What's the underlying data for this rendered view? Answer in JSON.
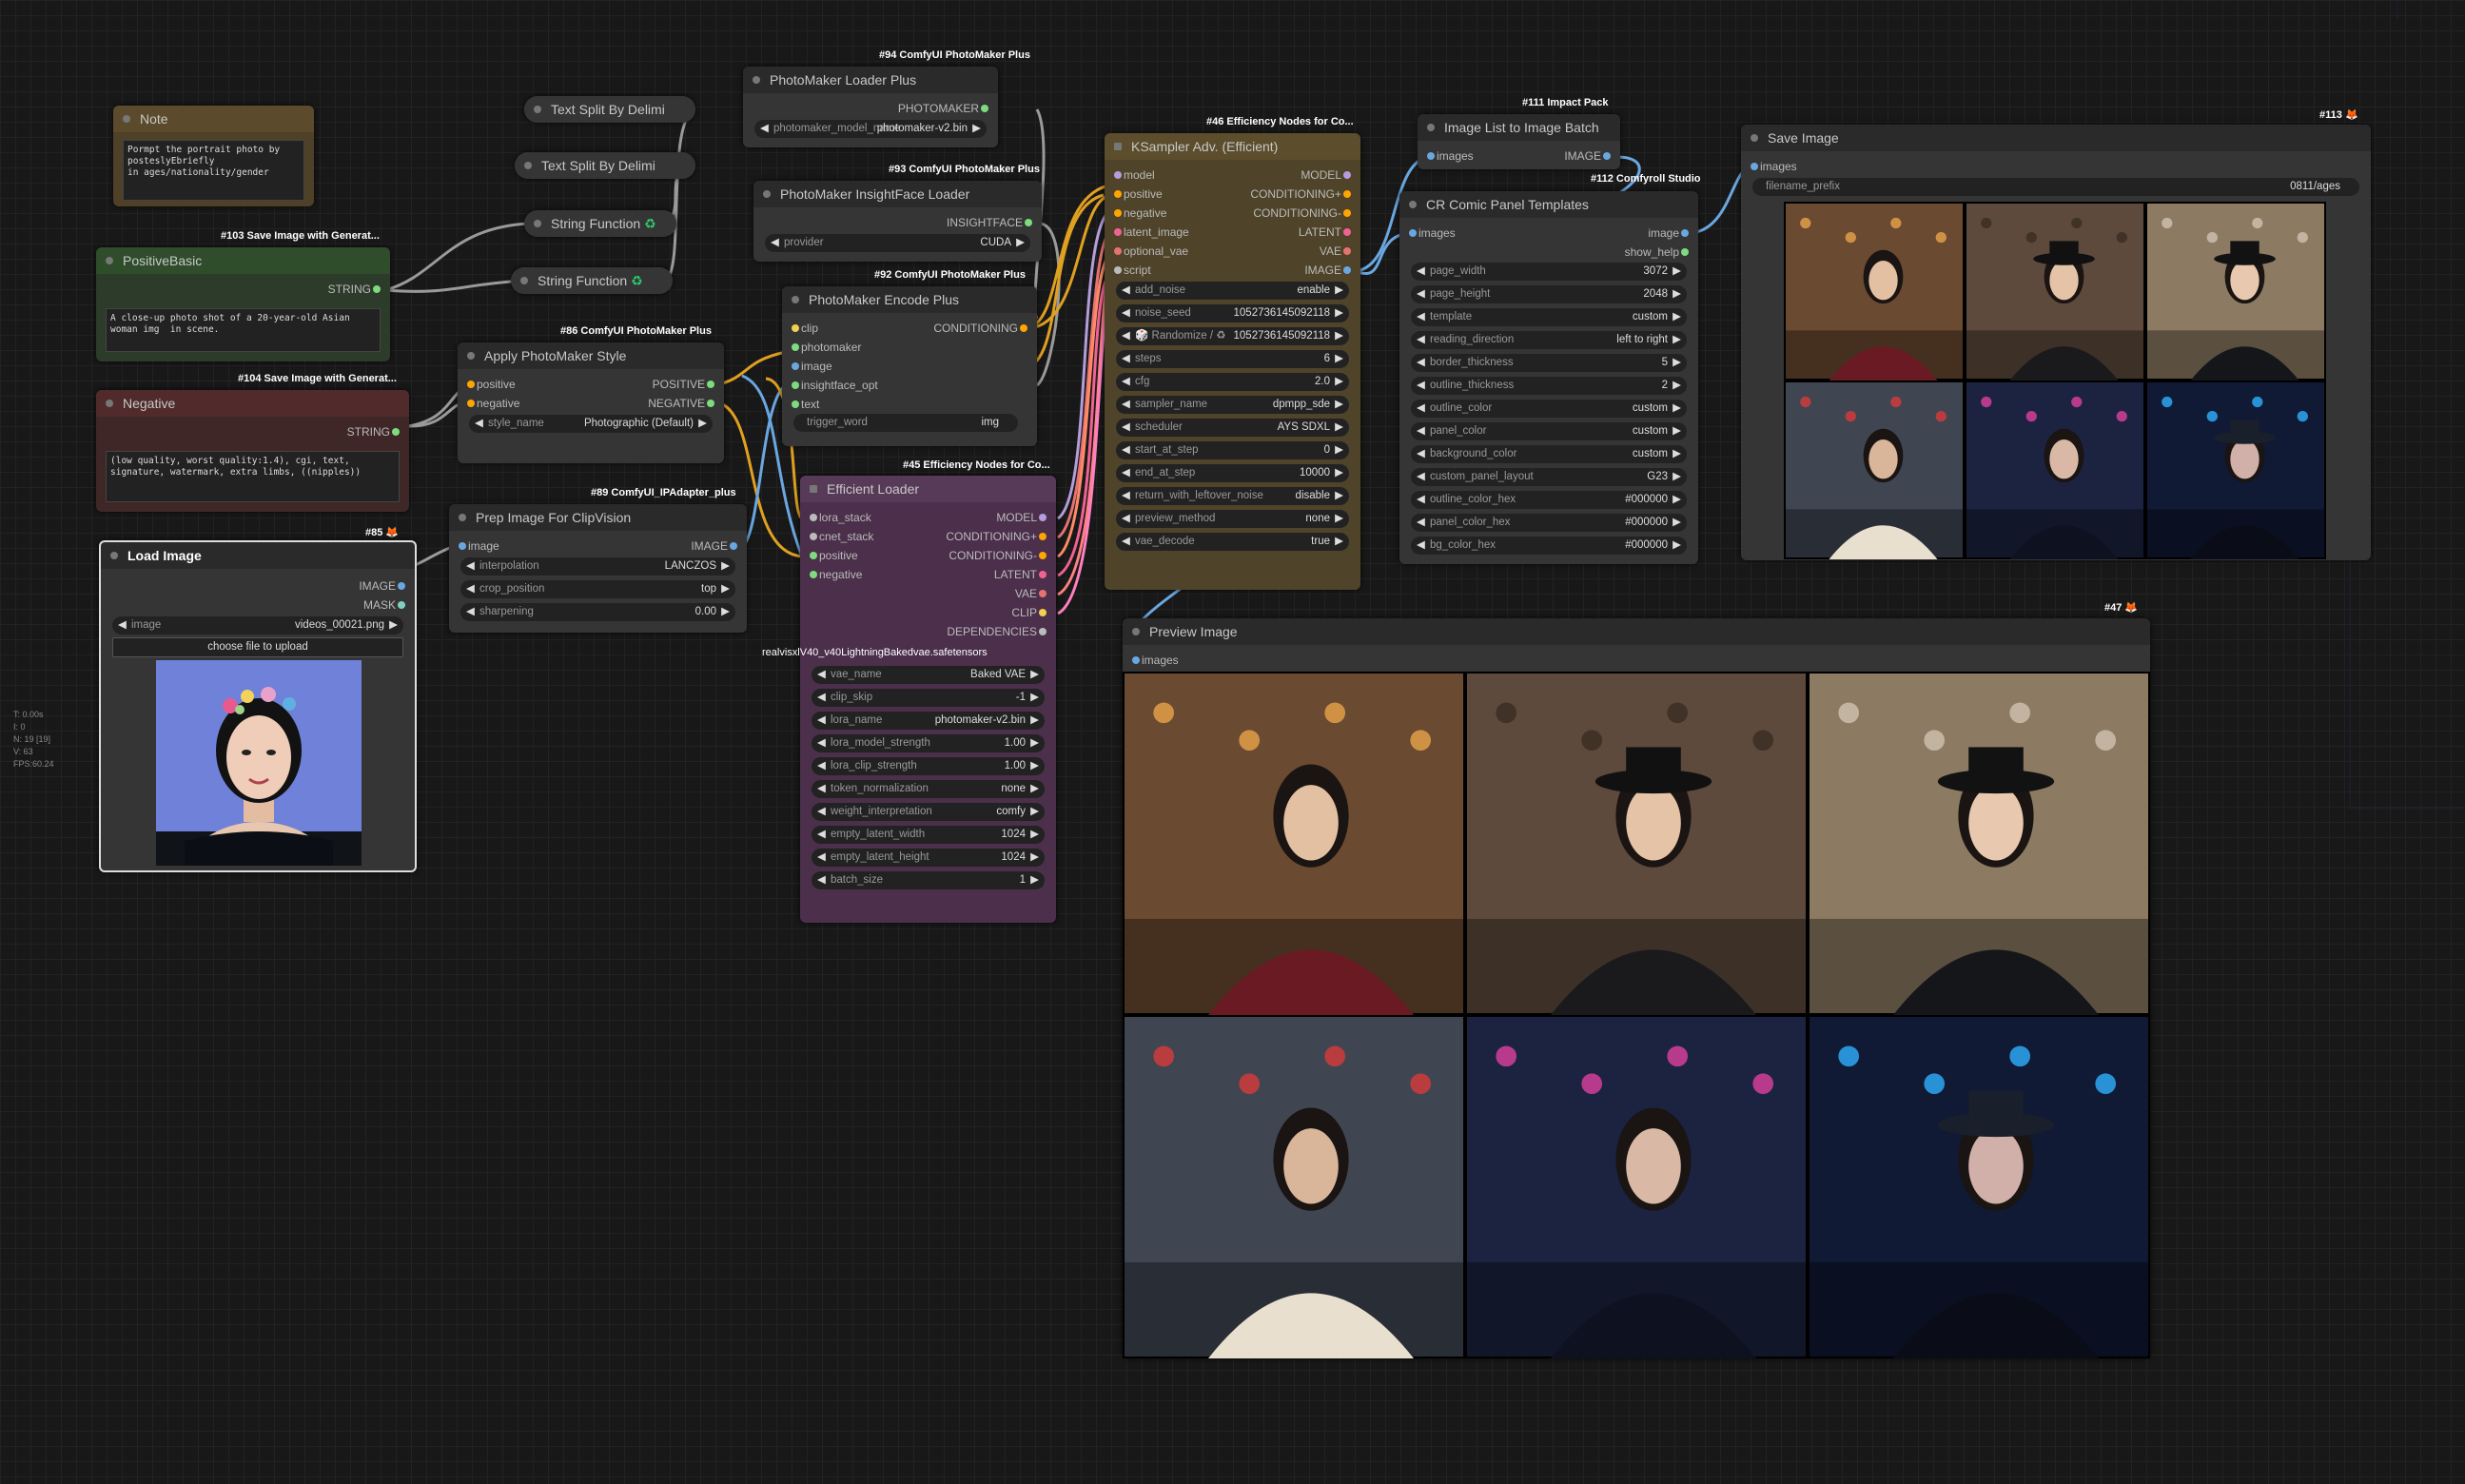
{
  "stats": [
    "T: 0.00s",
    "I: 0",
    "N: 19 [19]",
    "V: 63",
    "FPS:60.24"
  ],
  "note": {
    "title": "Note",
    "text": "Pormpt the portrait photo by\nposteslyEbriefly\nin ages/nationality/gender"
  },
  "positive": {
    "badge": "#103 Save Image with Generat...",
    "title": "PositiveBasic",
    "out": "STRING",
    "text": "A close-up photo shot of a 20-year-old Asian woman img  in scene."
  },
  "negative": {
    "badge": "#104 Save Image with Generat...",
    "title": "Negative",
    "out": "STRING",
    "text": "(low quality, worst quality:1.4), cgi, text, signature, watermark, extra limbs, ((nipples))"
  },
  "load_image": {
    "badge": "#85",
    "title": "Load Image",
    "out1": "IMAGE",
    "out2": "MASK",
    "w_name": "image",
    "w_val": "videos_00021.png",
    "upload": "choose file to upload"
  },
  "text_split1": {
    "title": "Text Split By Delimi"
  },
  "text_split2": {
    "title": "Text Split By Delimi"
  },
  "string_fn1": {
    "title": "String Function"
  },
  "string_fn2": {
    "title": "String Function"
  },
  "apply_style": {
    "badge": "#86 ComfyUI PhotoMaker Plus",
    "title": "Apply PhotoMaker Style",
    "in1": "positive",
    "in2": "negative",
    "out1": "POSITIVE",
    "out2": "NEGATIVE",
    "w_name": "style_name",
    "w_val": "Photographic (Default)"
  },
  "prep_clip": {
    "badge": "#89 ComfyUI_IPAdapter_plus",
    "title": "Prep Image For ClipVision",
    "in1": "image",
    "out1": "IMAGE",
    "w": [
      {
        "n": "interpolation",
        "v": "LANCZOS"
      },
      {
        "n": "crop_position",
        "v": "top"
      },
      {
        "n": "sharpening",
        "v": "0.00"
      }
    ]
  },
  "pm_loader": {
    "badge": "#94 ComfyUI PhotoMaker Plus",
    "title": "PhotoMaker Loader Plus",
    "out1": "PHOTOMAKER",
    "w_name": "photomaker_model_name",
    "w_val": "photomaker-v2.bin"
  },
  "pm_insight": {
    "badge": "#93 ComfyUI PhotoMaker Plus",
    "title": "PhotoMaker InsightFace Loader",
    "out1": "INSIGHTFACE",
    "w_name": "provider",
    "w_val": "CUDA"
  },
  "pm_encode": {
    "badge": "#92 ComfyUI PhotoMaker Plus",
    "title": "PhotoMaker Encode Plus",
    "ins": [
      "clip",
      "photomaker",
      "image",
      "insightface_opt",
      "text"
    ],
    "out1": "CONDITIONING",
    "w_name": "trigger_word",
    "w_val": "img"
  },
  "eff_loader": {
    "badge": "#45 Efficiency Nodes for Co...",
    "title": "Efficient Loader",
    "ins": [
      "lora_stack",
      "cnet_stack",
      "positive",
      "negative"
    ],
    "outs": [
      "MODEL",
      "CONDITIONING+",
      "CONDITIONING-",
      "LATENT",
      "VAE",
      "CLIP",
      "DEPENDENCIES"
    ],
    "ckpt": "realvisxlV40_v40LightningBakedvae.safetensors",
    "w": [
      {
        "n": "vae_name",
        "v": "Baked VAE"
      },
      {
        "n": "clip_skip",
        "v": "-1"
      },
      {
        "n": "lora_name",
        "v": "photomaker-v2.bin"
      },
      {
        "n": "lora_model_strength",
        "v": "1.00"
      },
      {
        "n": "lora_clip_strength",
        "v": "1.00"
      },
      {
        "n": "token_normalization",
        "v": "none"
      },
      {
        "n": "weight_interpretation",
        "v": "comfy"
      },
      {
        "n": "empty_latent_width",
        "v": "1024"
      },
      {
        "n": "empty_latent_height",
        "v": "1024"
      },
      {
        "n": "batch_size",
        "v": "1"
      }
    ]
  },
  "ksampler": {
    "badge": "#46 Efficiency Nodes for Co...",
    "title": "KSampler Adv. (Efficient)",
    "ins": [
      "model",
      "positive",
      "negative",
      "latent_image",
      "optional_vae",
      "script"
    ],
    "outs": [
      "MODEL",
      "CONDITIONING+",
      "CONDITIONING-",
      "LATENT",
      "VAE",
      "IMAGE"
    ],
    "w": [
      {
        "n": "add_noise",
        "v": "enable"
      },
      {
        "n": "noise_seed",
        "v": "1052736145092118"
      },
      {
        "n": "🎲 Randomize / ♻",
        "v": "1052736145092118"
      },
      {
        "n": "steps",
        "v": "6"
      },
      {
        "n": "cfg",
        "v": "2.0"
      },
      {
        "n": "sampler_name",
        "v": "dpmpp_sde"
      },
      {
        "n": "scheduler",
        "v": "AYS SDXL"
      },
      {
        "n": "start_at_step",
        "v": "0"
      },
      {
        "n": "end_at_step",
        "v": "10000"
      },
      {
        "n": "return_with_leftover_noise",
        "v": "disable"
      },
      {
        "n": "preview_method",
        "v": "none"
      },
      {
        "n": "vae_decode",
        "v": "true"
      }
    ]
  },
  "img_list": {
    "badge": "#111 Impact Pack",
    "title": "Image List to Image Batch",
    "in1": "images",
    "out1": "IMAGE"
  },
  "comic": {
    "badge": "#112 Comfyroll Studio",
    "title": "CR Comic Panel Templates",
    "in1": "images",
    "out1": "image",
    "out2": "show_help",
    "w": [
      {
        "n": "page_width",
        "v": "3072"
      },
      {
        "n": "page_height",
        "v": "2048"
      },
      {
        "n": "template",
        "v": "custom"
      },
      {
        "n": "reading_direction",
        "v": "left to right"
      },
      {
        "n": "border_thickness",
        "v": "5"
      },
      {
        "n": "outline_thickness",
        "v": "2"
      },
      {
        "n": "outline_color",
        "v": "custom"
      },
      {
        "n": "panel_color",
        "v": "custom"
      },
      {
        "n": "background_color",
        "v": "custom"
      },
      {
        "n": "custom_panel_layout",
        "v": "G23"
      },
      {
        "n": "outline_color_hex",
        "v": "#000000"
      },
      {
        "n": "panel_color_hex",
        "v": "#000000"
      },
      {
        "n": "bg_color_hex",
        "v": "#000000"
      }
    ]
  },
  "save_image": {
    "badge": "#113",
    "title": "Save Image",
    "in1": "images",
    "w_name": "filename_prefix",
    "w_val": "0811/ages"
  },
  "preview": {
    "badge": "#47",
    "title": "Preview Image",
    "in1": "images"
  }
}
